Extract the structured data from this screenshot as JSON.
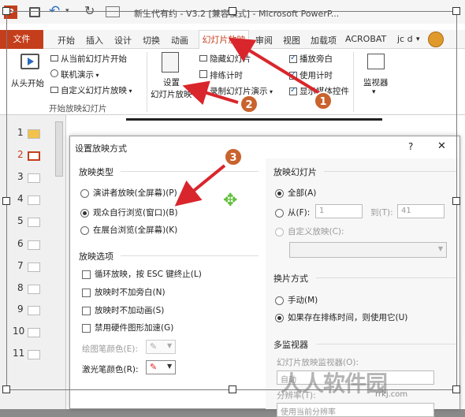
{
  "titlebar": {
    "title": "新生代有约 - V3.2 [兼容模式] - Microsoft PowerP...",
    "app_badge": "P"
  },
  "ribbon": {
    "tabs": [
      "开始",
      "插入",
      "设计",
      "切换",
      "动画",
      "幻灯片放映",
      "审阅",
      "视图",
      "加载项",
      "ACROBAT"
    ],
    "file_tab": "文件",
    "active_tab": "幻灯片放映",
    "user": "jc d",
    "start_group": {
      "from_start": "从头开始",
      "from_current": "从当前幻灯片开始",
      "online": "联机演示",
      "custom": "自定义幻灯片放映",
      "group_label": "开始放映幻灯片"
    },
    "setup_group": {
      "setup_button_line1": "设置",
      "setup_button_line2": "幻灯片放映",
      "hide_slide": "隐藏幻灯片",
      "rehearse": "排练计时",
      "record": "录制幻灯片演示"
    },
    "checkboxes": {
      "play_narration": "播放旁白",
      "use_timings": "使用计时",
      "show_controls": "显示媒体控件"
    },
    "monitors": "监视器"
  },
  "thumbnails": [
    "1",
    "2",
    "3",
    "4",
    "5",
    "6",
    "7",
    "8",
    "9",
    "10",
    "11"
  ],
  "dialog": {
    "title": "设置放映方式",
    "help": "?",
    "close": "✕",
    "show_type": {
      "label": "放映类型",
      "options": [
        "演讲者放映(全屏幕)(P)",
        "观众自行浏览(窗口)(B)",
        "在展台浏览(全屏幕)(K)"
      ],
      "selected_index": 1
    },
    "show_options": {
      "label": "放映选项",
      "options": [
        "循环放映，按 ESC 键终止(L)",
        "放映时不加旁白(N)",
        "放映时不加动画(S)",
        "禁用硬件图形加速(G)"
      ],
      "pen_color": "绘图笔颜色(E):",
      "laser_color": "激光笔颜色(R):"
    },
    "slides": {
      "label": "放映幻灯片",
      "all": "全部(A)",
      "from": "从(F):",
      "from_value": "1",
      "to": "到(T):",
      "to_value": "41",
      "custom": "自定义放映(C):"
    },
    "advance": {
      "label": "换片方式",
      "manual": "手动(M)",
      "timings": "如果存在排练时间，则使用它(U)"
    },
    "multi_monitor": {
      "label": "多监视器",
      "monitor_label": "幻灯片放映监视器(O):",
      "monitor_value": "自动",
      "resolution_label": "分辨率(T):",
      "resolution_value": "使用当前分辨率"
    }
  },
  "annotations": [
    "1",
    "2",
    "3"
  ],
  "watermark": {
    "main": "人人软件园",
    "sub": "rrkj.com"
  },
  "colors": {
    "accent": "#c43e1c",
    "arrow": "#d9262c",
    "badge": "#c9632d"
  }
}
